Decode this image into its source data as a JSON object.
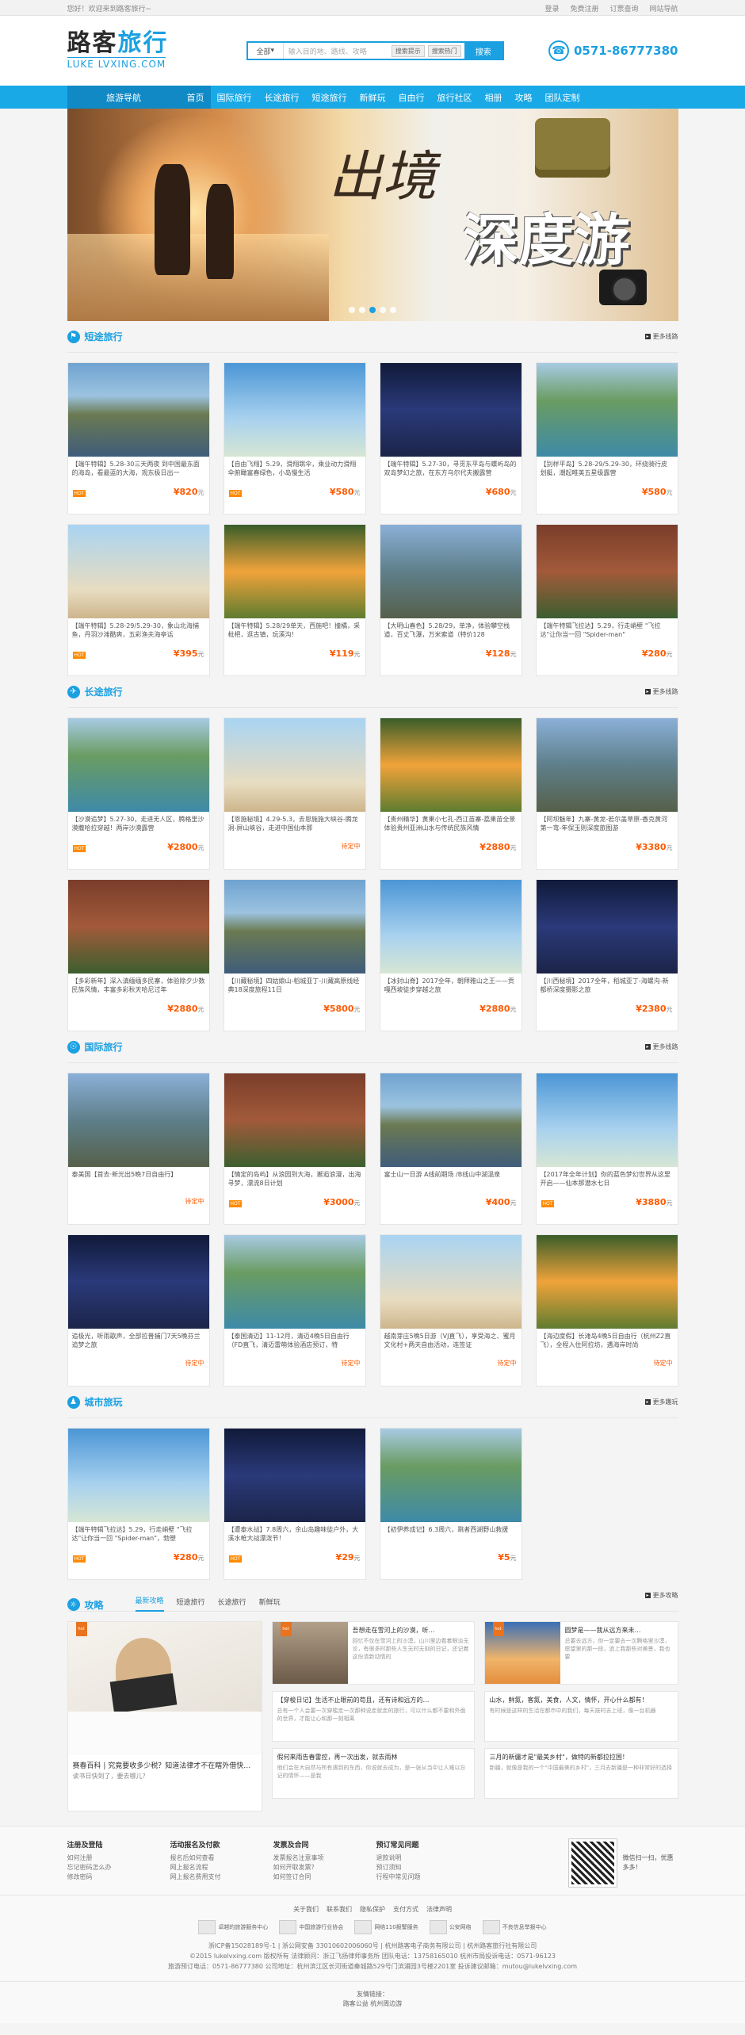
{
  "topbar": {
    "welcome": "您好！欢迎来到路客旅行~",
    "links": [
      "登录",
      "免费注册",
      "订票查询",
      "网站导航"
    ]
  },
  "header": {
    "logo_cn_left": "路客",
    "logo_cn_right": "旅行",
    "logo_en": "LUKE LVXING.COM",
    "search": {
      "select": "全部",
      "placeholder": "输入目的地、路线、攻略",
      "tags": [
        "搜索提示",
        "搜索热门"
      ],
      "button": "搜索"
    },
    "phone": "0571-86777380"
  },
  "nav": {
    "head": "旅游导航",
    "items": [
      "首页",
      "国际旅行",
      "长途旅行",
      "短途旅行",
      "新鲜玩",
      "自由行",
      "旅行社区",
      "相册",
      "攻略",
      "团队定制"
    ]
  },
  "banner": {
    "title1": "出境",
    "title2": "深度游",
    "dots": 5,
    "active_dot": 3
  },
  "sections": [
    {
      "title": "短途旅行",
      "more": "更多线路",
      "cards": [
        {
          "desc": "【端午特辑】5.28-30三天两夜 到中国最东面的海岛，看最蓝的大海，观东极日出一",
          "price": "820",
          "unit": "元",
          "hot": true
        },
        {
          "desc": "【自由飞翔】5.29，滑翔跳伞，乘业动力滑翔伞俯瞰富春绿色，小岛慢生活",
          "price": "580",
          "unit": "元",
          "hot": true
        },
        {
          "desc": "【端午特辑】5.27-30，寻觅东平岛与蝶屿岛的双岛梦幻之旅，在东方乌尔代夫搬露营",
          "price": "680",
          "unit": "元",
          "hot": false
        },
        {
          "desc": "【别样平岛】5.28-29/5.29-30，环绕骑行皮划艇，潮起唯美五星级露营",
          "price": "580",
          "unit": "元",
          "hot": false
        },
        {
          "desc": "【端午特辑】5.28-29/5.29-30，象山北海捕鱼，丹羽沙滩酷爽，五彩渔夫海亭话",
          "price": "395",
          "unit": "元",
          "hot": true
        },
        {
          "desc": "【端午特辑】5.28/29单天，西施吧！撞橘，采枇杷，逛古镇，玩溪沟！",
          "price": "119",
          "unit": "元",
          "hot": false
        },
        {
          "desc": "【大明山春色】5.28/29，单净，体验攀空栈道，百丈飞瀑，万米索道（特价128",
          "price": "128",
          "unit": "元",
          "hot": false
        },
        {
          "desc": "【端午特辑飞拉达】5.29，行走峭壁 \"飞拉达\"让你当一回 \"Spider-man\"",
          "price": "280",
          "unit": "元",
          "hot": false
        }
      ]
    },
    {
      "title": "长途旅行",
      "more": "更多线路",
      "cards": [
        {
          "desc": "【沙漠追梦】5.27-30，走进无人区，腾格里沙漠撒哈拉穿越！两岸沙漠露营",
          "price": "2800",
          "unit": "元",
          "hot": true
        },
        {
          "desc": "【恩施秘境】4.29-5.3，去恩施施大峡谷-腾龙洞-屏山峡谷，走进中国仙本那",
          "price": "",
          "unit": "",
          "tbd": "待定中",
          "hot": false
        },
        {
          "desc": "【贵州精华】黄果小七孔-西江苗寨-荔果苗全景体验贵州亚洲山水与传统民族风情",
          "price": "2880",
          "unit": "元",
          "hot": false
        },
        {
          "desc": "【阿坝魅年】九寨-黄龙-若尔盖草原-香克黄河第一弯-年保玉则深度旅图游",
          "price": "3380",
          "unit": "元",
          "hot": false
        },
        {
          "desc": "【多彩新年】深入滇缅缅多民寨，体验除夕少数民族风情，丰富多彩秋天哈尼过年",
          "price": "2880",
          "unit": "元",
          "hot": false
        },
        {
          "desc": "【川藏秘境】四姑娘山-稻城亚丁-川藏高原线经典18深度旅程11日",
          "price": "5800",
          "unit": "元",
          "hot": false
        },
        {
          "desc": "【冰封山脊】2017全年，朝拜雅山之王——贡嘎西坡徒步穿越之旅",
          "price": "2880",
          "unit": "元",
          "hot": false
        },
        {
          "desc": "【川西秘境】2017全年，稻城亚丁-海螺沟-新都桥深度摄影之旅",
          "price": "2380",
          "unit": "元",
          "hot": false
        }
      ]
    },
    {
      "title": "国际旅行",
      "more": "更多线路",
      "cards": [
        {
          "desc": "泰美国【首去·新光出5晚7日自由行】",
          "price": "",
          "unit": "",
          "tbd": "待定中",
          "hot": false
        },
        {
          "desc": "【情定的岛屿】从浪园到大海，邂逅浪漫，出海寻梦，漂流8日计划",
          "price": "3000",
          "unit": "元",
          "hot": true
        },
        {
          "desc": "富士山一日游 A线前期场 /B线山中湖温泉",
          "price": "400",
          "unit": "元",
          "hot": false
        },
        {
          "desc": "【2017年全年计划】你的蓝色梦幻世界从这里开启——仙本那潜水七日",
          "price": "3880",
          "unit": "元",
          "hot": true
        },
        {
          "desc": "追极光，听雨歌声，全部拉普捕门7天5晚芬兰追梦之旅",
          "price": "",
          "unit": "",
          "tbd": "待定中",
          "hot": false
        },
        {
          "desc": "【泰国清迈】11-12月，清迈4晚5日自由行（FD直飞，清迈雷萌体验酒店预订，特",
          "price": "",
          "unit": "",
          "tbd": "待定中",
          "hot": false
        },
        {
          "desc": "越南芽庄5晚5日游（VJ直飞），享受海之、蜜月文化村+两天自由活动，连签证",
          "price": "",
          "unit": "",
          "tbd": "待定中",
          "hot": false
        },
        {
          "desc": "【海边度假】长滩岛4晚5日自由行（杭州Z2直飞），全程入住阿拉坊，遇海岸时尚",
          "price": "",
          "unit": "",
          "tbd": "待定中",
          "hot": false
        }
      ]
    },
    {
      "title": "城市旅玩",
      "more": "更多趣玩",
      "cards": [
        {
          "desc": "【端午特辑飞拉达】5.29，行走峭壁 \"飞拉达\"让你当一回 \"Spider-man\"，勃塑",
          "price": "280",
          "unit": "元",
          "hot": true
        },
        {
          "desc": "【遭泰水战】7.8周六，余山岛趣味徒户外，大溪水枪大战漂泼节！",
          "price": "29",
          "unit": "元",
          "hot": true
        },
        {
          "desc": "【初伊养成记】6.3周六，跳者西湖野山救援",
          "price": "5",
          "unit": "元",
          "hot": false
        }
      ]
    }
  ],
  "strategy": {
    "title": "攻略",
    "tabs": [
      "最新攻略",
      "短途旅行",
      "长途旅行",
      "新鲜玩"
    ],
    "more": "更多攻略",
    "big": {
      "title": "赛春百科 | 究竟要收多少税？知道法律才不在瞎外借快…",
      "summary": "读书日快到了，要去哪儿？"
    },
    "posts": [
      {
        "title": "吾想走在雪河上的沙漠，听…",
        "summary": "回忆不仅在雪河上的沙漠，山川里边看着眼淡无论，有很多时那些人生无时无刻的日记，还记着这份清新动情的"
      },
      {
        "title": "圆梦是——我从远方来未…",
        "summary": "总要去远方，你一定要去一次腾格里沙漠，愿望里的那一段，追上我那些对美景，我也要"
      },
      {
        "title": "【穿梭日记】生活不止眼前的苟且，还有诗和远方的…",
        "summary": "总有一个人会要一次穿梭走一次那种说走就走的旅行，可以什么都不要和外面的世界，才能让心和那一刻相离"
      },
      {
        "title": "山水，鲜氮，客氮，美食，人文，情怀，开心什么都有！",
        "summary": "有时候是这样的生活在都市中的我们，每天按时去上班，像一台机器"
      },
      {
        "title": "假何来雨告春雷控，再一次出发，就去雨林",
        "summary": "他们会在大自然与所有遇到的东西，你说就去成为，是一张从当中让人难以忘记的情怀——是我"
      },
      {
        "title": "三月的新疆才是\"最美乡村\"，做特的新都拉拉国！",
        "summary": "新疆，就像是我的一个\"中国最美的乡村\"，三月去新疆是一种非常好的选择"
      }
    ]
  },
  "footer": {
    "cols": [
      {
        "title": "注册及登陆",
        "items": [
          "如何注册",
          "忘记密码怎么办",
          "修改密码"
        ]
      },
      {
        "title": "活动报名及付款",
        "items": [
          "报名后如何查看",
          "网上报名流程",
          "网上报名费用支付"
        ]
      },
      {
        "title": "发票及合同",
        "items": [
          "发票报名注意事项",
          "如何开取发票？",
          "如何签订合同"
        ]
      },
      {
        "title": "预订常见问题",
        "items": [
          "退款说明",
          "预订须知",
          "行程中常见问题"
        ]
      }
    ],
    "qr_text": "微信扫一扫，优惠多多！",
    "links": [
      "关于我们",
      "联系我们",
      "隐私保护",
      "支付方式",
      "法律声明"
    ],
    "badges": [
      "卓越的旅游服务中心",
      "中国旅游行业协会",
      "网络110报警服务",
      "公安网络",
      "不良信息举报中心"
    ],
    "info": [
      "浙ICP备15028189号-1 | 浙公网安备 33010602006060号 | 杭州路客电子商务有限公司 | 杭州路客旅行社有限公司",
      "©2015 lukelvxing.com 版权所有 法律顾问：浙江飞扬律师事务所 团队电话：13758165010 杭州市局投诉电话：0571-96123",
      "旅游预订电话：0571-86777380 公司地址：杭州滨江区长河街道秦城路529号门滨浦园3号楼2201室 投诉建议邮箱：mutou@lukelvxing.com"
    ],
    "friend_title": "友情链接：",
    "friend_links": "路客公益 杭州周边游"
  },
  "colors": {
    "accent": "#1ba0e1",
    "nav": "#1aa9e7",
    "price": "#ff5a00",
    "hot": "#ff8a00"
  }
}
